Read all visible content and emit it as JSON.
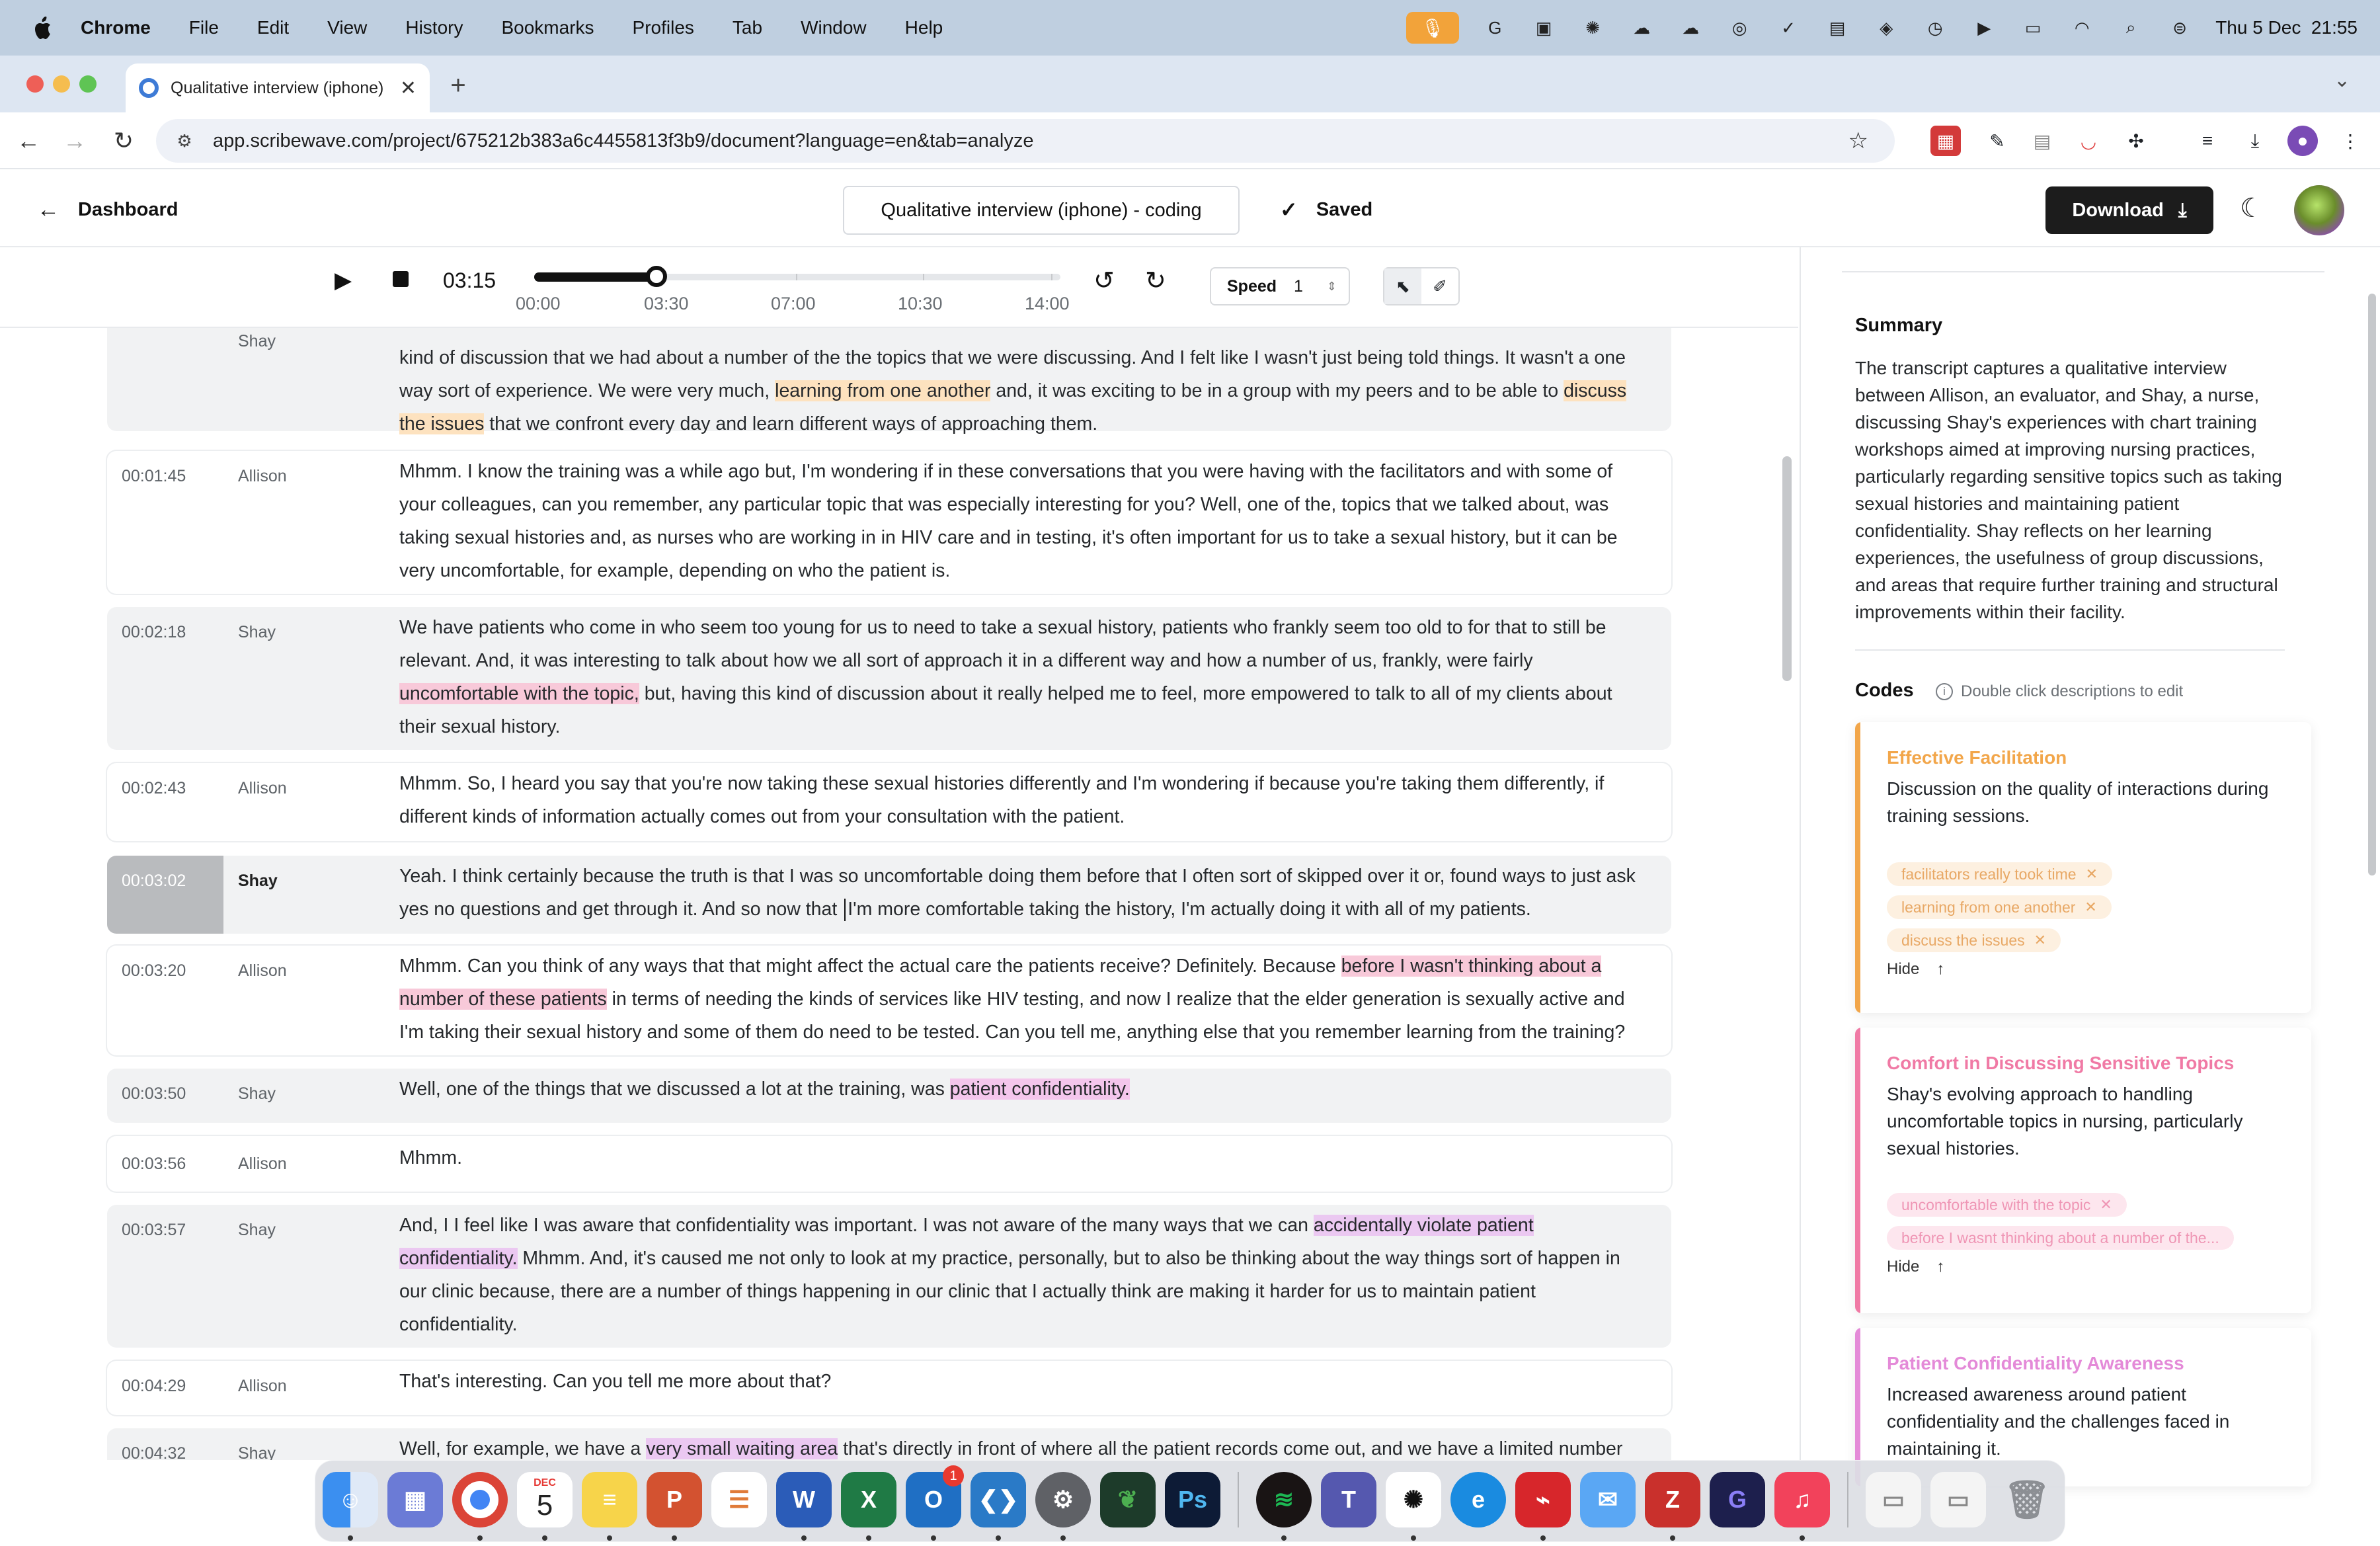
{
  "menubar": {
    "app": "Chrome",
    "items": [
      "File",
      "Edit",
      "View",
      "History",
      "Bookmarks",
      "Profiles",
      "Tab",
      "Window",
      "Help"
    ],
    "datetime": "Thu 5 Dec  21:55"
  },
  "browser": {
    "tab_title": "Qualitative interview (iphone)",
    "url": "app.scribewave.com/project/675212b383a6c4455813f3b9/document?language=en&tab=analyze"
  },
  "header": {
    "back_label": "Dashboard",
    "doc_title": "Qualitative interview (iphone) - coding",
    "saved_label": "Saved",
    "download_label": "Download"
  },
  "player": {
    "current_time": "03:15",
    "progress_fraction": 0.232,
    "ticks": [
      "00:00",
      "03:30",
      "07:00",
      "10:30",
      "14:00"
    ],
    "speed_label": "Speed",
    "speed_value": "1"
  },
  "segments": [
    {
      "time": "",
      "speaker": "Shay",
      "lines": [
        "kind of discussion that we had about a number of the the topics that we were discussing. And I felt like I wasn't just being told things. It wasn't a one",
        "way sort of experience. We were very much, learning from one another and, it was exciting to be in a group with my peers and to be able to discuss",
        "the issues that we confront every day and learn different ways of approaching them."
      ]
    },
    {
      "time": "00:01:45",
      "speaker": "Allison",
      "text": "Mhmm. I know the training was a while ago but, I'm wondering if in these conversations that you were having with the facilitators and with some of your colleagues, can you remember, any particular topic that was especially interesting for you? Well, one of the, topics that we talked about, was taking sexual histories and, as nurses who are working in in HIV care and in testing, it's often important for us to take a sexual history, but it can be very uncomfortable, for example, depending on who the patient is."
    },
    {
      "time": "00:02:18",
      "speaker": "Shay",
      "pre": "We have patients who come in who seem too young for us to need to take a sexual history, patients who frankly seem too old to for that to still be relevant. And, it was interesting to talk about how we all sort of approach it in a different way and how a number of us, frankly, were fairly ",
      "hl": "uncomfortable with the topic,",
      "post": " but, having this kind of discussion about it really helped me to feel, more empowered to talk to all of my clients about their sexual history."
    },
    {
      "time": "00:02:43",
      "speaker": "Allison",
      "text": "Mhmm. So, I heard you say that you're now taking these sexual histories differently and I'm wondering if because you're taking them differently, if different kinds of information actually comes out from your consultation with the patient."
    },
    {
      "time": "00:03:02",
      "speaker": "Shay",
      "pre": "Yeah. I think certainly because the truth is that I was so uncomfortable doing them before that I often sort of skipped over it or, found ways to just ask yes no questions and get through it. And so now that ",
      "post": "I'm more comfortable taking the history, I'm actually doing it with all of my patients."
    },
    {
      "time": "00:03:20",
      "speaker": "Allison",
      "pre": "Mhmm. Can you think of any ways that that might affect the actual care the patients receive? Definitely. Because ",
      "hl": "before I wasn't thinking about a number of these patients",
      "post": " in terms of needing the kinds of services like HIV testing, and now I realize that the elder generation is sexually active and I'm taking their sexual history and some of them do need to be tested. Can you tell me, anything else that you remember learning from the training?"
    },
    {
      "time": "00:03:50",
      "speaker": "Shay",
      "pre": "Well, one of the things that we discussed a lot at the training, was ",
      "hl": "patient confidentiality.",
      "post": ""
    },
    {
      "time": "00:03:56",
      "speaker": "Allison",
      "text": "Mhmm."
    },
    {
      "time": "00:03:57",
      "speaker": "Shay",
      "pre": "And, I I feel like I was aware that confidentiality was important. I was not aware of the many ways that we can ",
      "hl": "accidentally violate patient confidentiality.",
      "post": " Mhmm. And, it's caused me not only to look at my practice, personally, but to also be thinking about the way things sort of happen in our clinic because, there are a number of things happening in our clinic that I actually think are making it harder for us to maintain patient confidentiality."
    },
    {
      "time": "00:04:29",
      "speaker": "Allison",
      "text": "That's interesting. Can you tell me more about that?"
    },
    {
      "time": "00:04:32",
      "speaker": "Shay",
      "pre": "Well, for example, we have a ",
      "hl": "very small waiting area",
      "post": " that's directly in front of where all the patient records come out, and we have a limited number"
    }
  ],
  "sidebar": {
    "summary_title": "Summary",
    "summary_text": "The transcript captures a qualitative interview between Allison, an evaluator, and Shay, a nurse, discussing Shay's experiences with chart training workshops aimed at improving nursing practices, particularly regarding sensitive topics such as taking sexual histories and maintaining patient confidentiality. Shay reflects on her learning experiences, the usefulness of group discussions, and areas that require further training and structural improvements within their facility.",
    "codes_title": "Codes",
    "codes_hint": "Double click descriptions to edit",
    "codes": [
      {
        "title": "Effective Facilitation",
        "description": "Discussion on the quality of interactions during training sessions.",
        "color": "#f2a64a",
        "chips": [
          "facilitators really took time",
          "learning from one another",
          "discuss the issues"
        ],
        "hide_label": "Hide"
      },
      {
        "title": "Comfort in Discussing Sensitive Topics",
        "description": "Shay's evolving approach to handling uncomfortable topics in nursing, particularly sexual histories.",
        "color": "#f07aa5",
        "chips": [
          "uncomfortable with the topic",
          "before I wasnt thinking about a number of the..."
        ],
        "hide_label": "Hide"
      },
      {
        "title": "Patient Confidentiality Awareness",
        "description": "Increased awareness around patient confidentiality and the challenges faced in maintaining it.",
        "color": "#e48ad8"
      }
    ]
  },
  "dock": {
    "calendar_month": "DEC",
    "calendar_day": "5",
    "outlook_badge": "1"
  }
}
